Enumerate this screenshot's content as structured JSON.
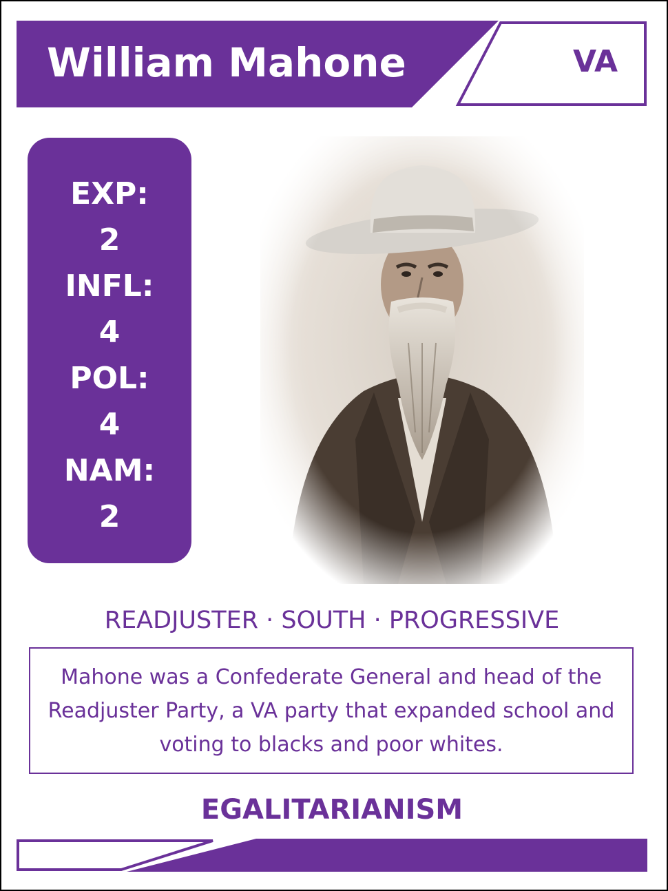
{
  "card": {
    "name": "William Mahone",
    "state": "VA",
    "stats": [
      {
        "label": "EXP:",
        "value": "2"
      },
      {
        "label": "INFL:",
        "value": "4"
      },
      {
        "label": "POL:",
        "value": "4"
      },
      {
        "label": "NAM:",
        "value": "2"
      }
    ],
    "tags": "READJUSTER · SOUTH · PROGRESSIVE",
    "description": "Mahone was a Confederate General and head of the Readjuster Party, a VA party that expanded school and voting to blacks and poor whites.",
    "keyword": "EGALITARIANISM",
    "portrait_icon": "bearded-man-portrait-icon"
  },
  "colors": {
    "accent": "#6a3199",
    "background": "#ffffff",
    "photo_sepia": "#6b5a4a"
  }
}
